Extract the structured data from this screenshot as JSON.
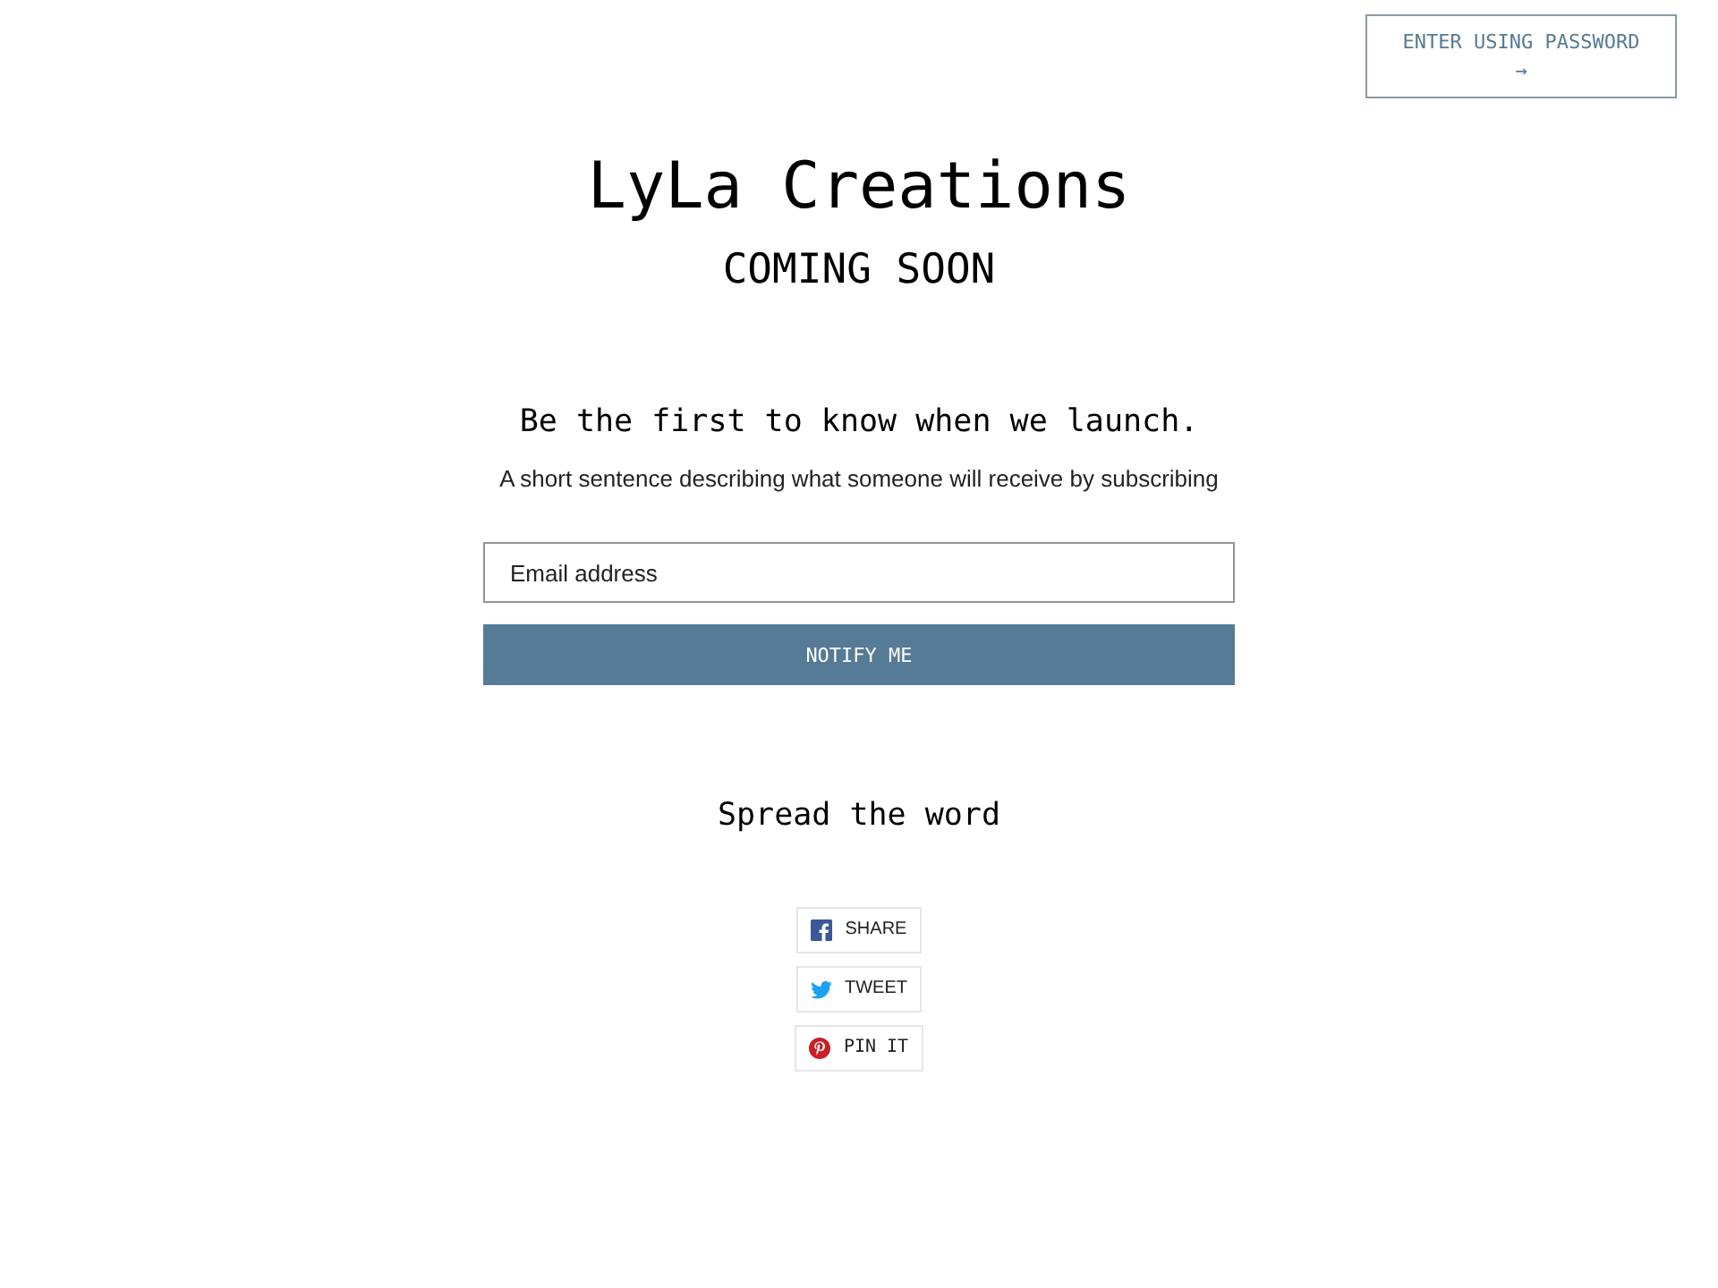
{
  "password_button": {
    "label": "ENTER USING PASSWORD",
    "arrow": "→"
  },
  "store": {
    "title": "LyLa Creations",
    "subtitle": "COMING SOON"
  },
  "newsletter": {
    "heading": "Be the first to know when we launch.",
    "text": "A short sentence describing what someone will receive by subscribing",
    "email_field": {
      "placeholder": "Email address"
    },
    "submit_button": "NOTIFY ME"
  },
  "social": {
    "heading": "Spread the word",
    "buttons": [
      {
        "kind": "facebook",
        "label": "SHARE"
      },
      {
        "kind": "twitter",
        "label": "TWEET"
      },
      {
        "kind": "pinterest",
        "label": "PIN IT"
      }
    ]
  }
}
